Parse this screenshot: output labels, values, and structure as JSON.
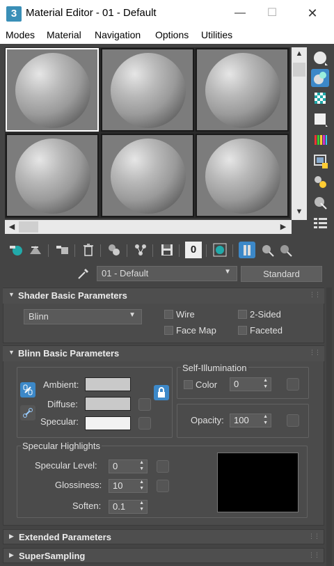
{
  "window": {
    "app_icon": "3",
    "title": "Material Editor - 01 - Default",
    "minimize": "—",
    "maximize": "☐",
    "close": "✕"
  },
  "menu": [
    "Modes",
    "Material",
    "Navigation",
    "Options",
    "Utilities"
  ],
  "material": {
    "name": "01 - Default",
    "type": "Standard"
  },
  "rollouts": {
    "shader": {
      "title": "Shader Basic Parameters",
      "shader_type": "Blinn",
      "wire": "Wire",
      "two_sided": "2-Sided",
      "face_map": "Face Map",
      "faceted": "Faceted"
    },
    "blinn": {
      "title": "Blinn Basic Parameters",
      "ambient": "Ambient:",
      "diffuse": "Diffuse:",
      "specular": "Specular:",
      "ambient_color": "#c9c9c9",
      "diffuse_color": "#c9c9c9",
      "specular_color": "#f2f2f2",
      "self_illum_title": "Self-Illumination",
      "color_label": "Color",
      "self_illum_value": "0",
      "opacity_label": "Opacity:",
      "opacity_value": "100",
      "highlights_title": "Specular Highlights",
      "spec_level_label": "Specular Level:",
      "spec_level": "0",
      "glossiness_label": "Glossiness:",
      "glossiness": "10",
      "soften_label": "Soften:",
      "soften": "0.1"
    },
    "extended": {
      "title": "Extended Parameters"
    },
    "supersampling": {
      "title": "SuperSampling"
    }
  },
  "toolbar": {
    "material_id": "0"
  },
  "colors": {
    "accent_blue": "#3c88c8",
    "panel": "#444444",
    "rollout": "#4b4b4b"
  }
}
